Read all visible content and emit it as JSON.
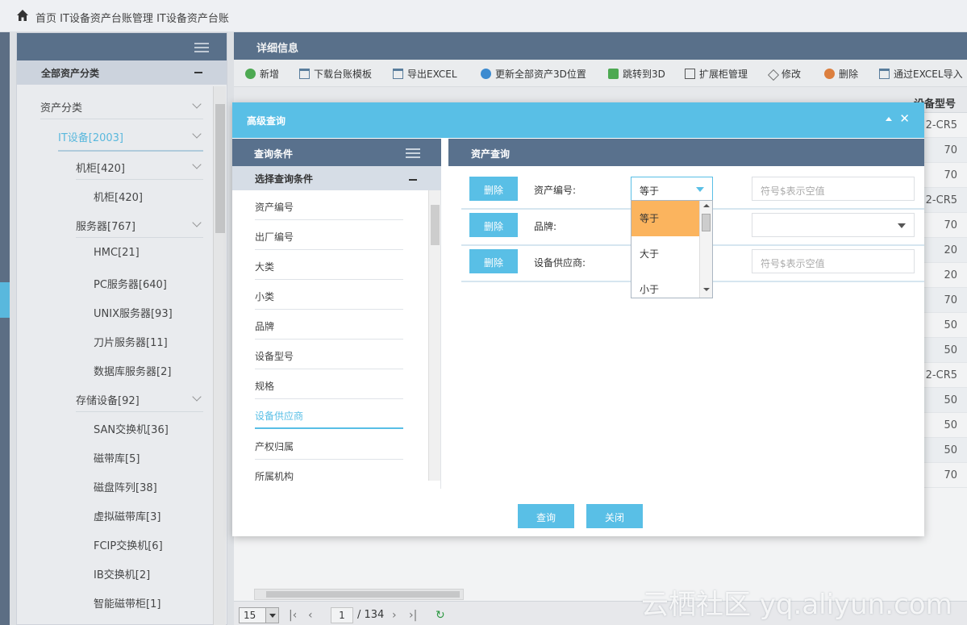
{
  "breadcrumb": {
    "items": [
      "首页",
      "IT设备资产台账管理",
      "IT设备资产台账"
    ]
  },
  "left_panel": {
    "header_title": "",
    "subtitle": "全部资产分类",
    "tree": [
      {
        "label": "资产分类"
      },
      {
        "label": "IT设备[2003]"
      },
      {
        "label": "机柜[420]"
      },
      {
        "label": "机柜[420]"
      },
      {
        "label": "服务器[767]"
      },
      {
        "label": "HMC[21]"
      },
      {
        "label": "PC服务器[640]"
      },
      {
        "label": "UNIX服务器[93]"
      },
      {
        "label": "刀片服务器[11]"
      },
      {
        "label": "数据库服务器[2]"
      },
      {
        "label": "存储设备[92]"
      },
      {
        "label": "SAN交换机[36]"
      },
      {
        "label": "磁带库[5]"
      },
      {
        "label": "磁盘阵列[38]"
      },
      {
        "label": "虚拟磁带库[3]"
      },
      {
        "label": "FCIP交换机[6]"
      },
      {
        "label": "IB交换机[2]"
      },
      {
        "label": "智能磁带柜[1]"
      }
    ]
  },
  "main": {
    "title": "详细信息",
    "toolbar": [
      "新增",
      "下载台账模板",
      "导出EXCEL",
      "更新全部资产3D位置",
      "跳转到3D",
      "扩展柜管理",
      "修改",
      "删除",
      "通过EXCEL导入"
    ],
    "header_visible": "设备型号",
    "grid_values": [
      "2-CR5",
      "70",
      "70",
      "2-CR5",
      "70",
      "20",
      "20",
      "70",
      "50",
      "50",
      "2-CR5",
      "50",
      "50",
      "50",
      "70"
    ],
    "pager": {
      "page_size": "15",
      "current_page": "1",
      "total": "/ 134"
    }
  },
  "dialog": {
    "title": "高级查询",
    "query_panel": {
      "title": "查询条件",
      "subtitle": "选择查询条件",
      "items": [
        "资产编号",
        "出厂编号",
        "大类",
        "小类",
        "品牌",
        "设备型号",
        "规格",
        "设备供应商",
        "产权归属",
        "所属机构"
      ]
    },
    "asset_panel": {
      "title": "资产查询",
      "rows": [
        {
          "delete": "删除",
          "label": "资产编号:",
          "operator": "等于",
          "placeholder": "符号$表示空值"
        },
        {
          "delete": "删除",
          "label": "品牌:",
          "operator": "",
          "placeholder": ""
        },
        {
          "delete": "删除",
          "label": "设备供应商:",
          "operator": "",
          "placeholder": "符号$表示空值"
        }
      ]
    },
    "operator_options": [
      "等于",
      "大于",
      "小于"
    ],
    "buttons": {
      "query": "查询",
      "close": "关闭"
    }
  },
  "watermark": "云栖社区 yq.aliyun.com",
  "colors": {
    "accent": "#59bfe6",
    "header": "#59718d",
    "highlight": "#fbb45e"
  }
}
